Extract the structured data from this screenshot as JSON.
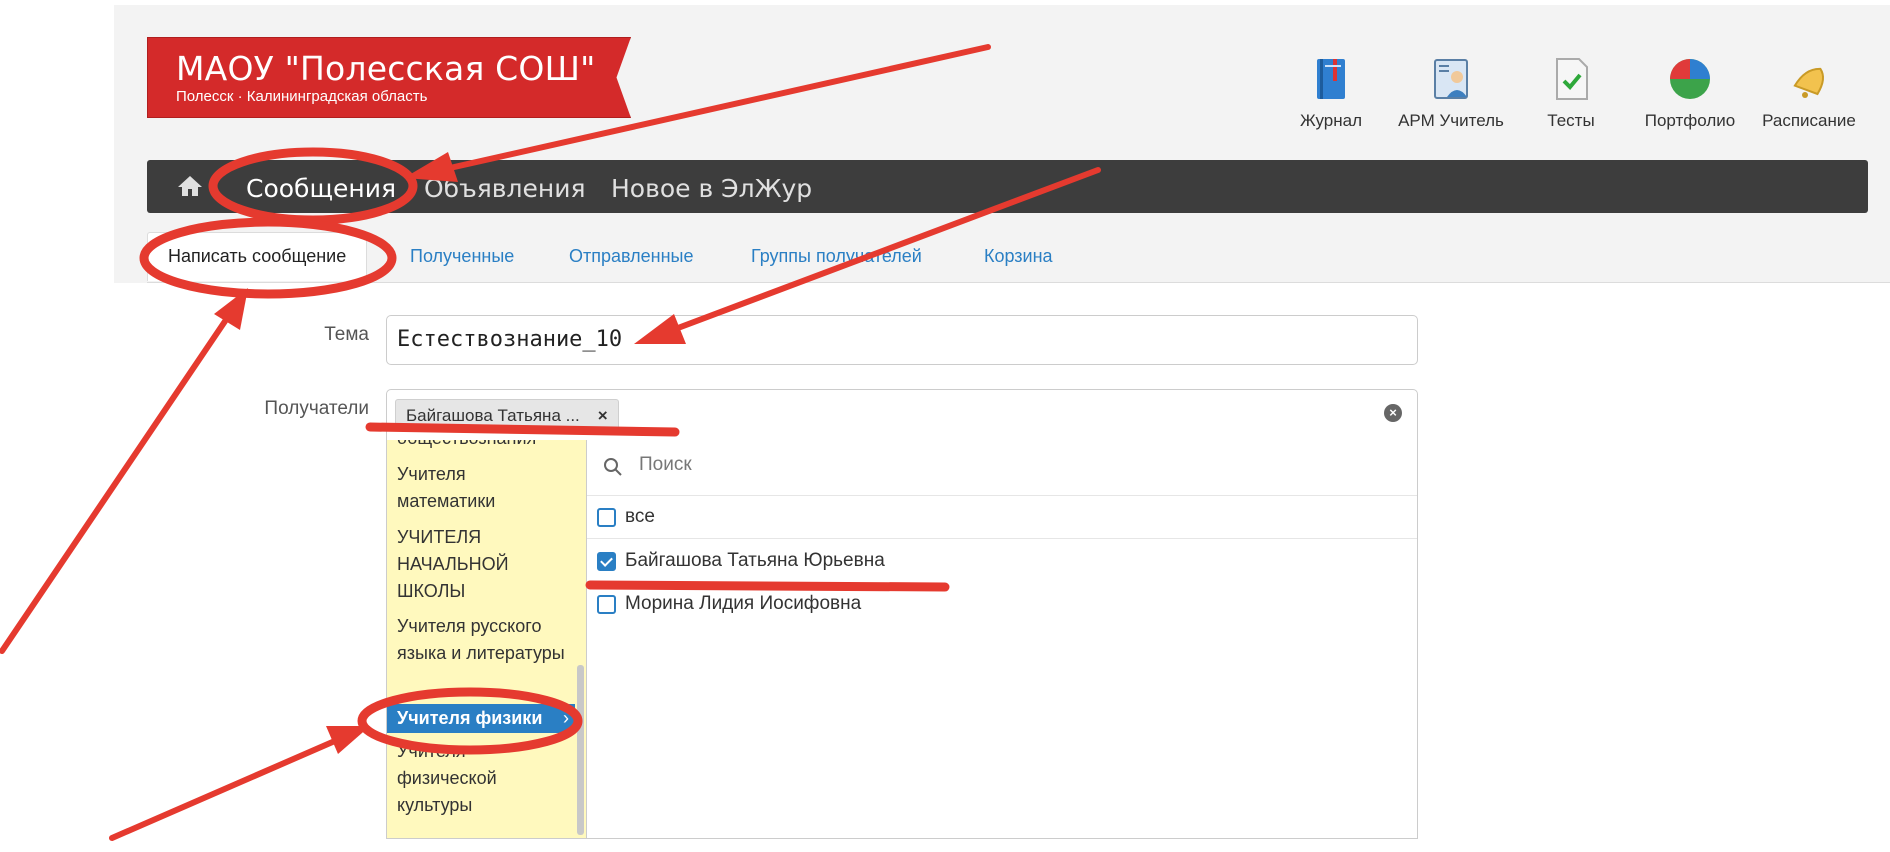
{
  "school": {
    "name": "МАОУ \"Полесская СОШ\"",
    "location": "Полесск · Калининградская область"
  },
  "quick_links": [
    {
      "label": "Журнал",
      "icon": "journal-icon"
    },
    {
      "label": "АРМ Учитель",
      "icon": "teacher-workstation-icon"
    },
    {
      "label": "Тесты",
      "icon": "tests-icon"
    },
    {
      "label": "Портфолио",
      "icon": "portfolio-pie-icon"
    },
    {
      "label": "Расписание",
      "icon": "bell-icon"
    }
  ],
  "nav": {
    "home_icon": "home-icon",
    "items": [
      {
        "label": "Сообщения",
        "active": true
      },
      {
        "label": "Объявления",
        "active": false
      },
      {
        "label": "Новое в ЭлЖур",
        "active": false
      }
    ]
  },
  "subtabs": [
    {
      "label": "Написать сообщение",
      "active": true
    },
    {
      "label": "Полученные",
      "active": false
    },
    {
      "label": "Отправленные",
      "active": false
    },
    {
      "label": "Группы получателей",
      "active": false
    },
    {
      "label": "Корзина",
      "active": false
    }
  ],
  "form": {
    "subject_label": "Тема",
    "subject_value": "Естествознание_10",
    "recipients_label": "Получатели",
    "recipient_chip": "Байгашова Татьяна ...",
    "chip_remove": "×",
    "clear_all": "×"
  },
  "groups": [
    {
      "label": "обществознания",
      "active": false
    },
    {
      "label": "Учителя математики",
      "active": false
    },
    {
      "label": "УЧИТЕЛЯ НАЧАЛЬНОЙ ШКОЛЫ",
      "active": false
    },
    {
      "label": "Учителя русского языка и литературы",
      "active": false
    },
    {
      "label": "Учителя физики",
      "active": true,
      "chevron": "›"
    },
    {
      "label": "Учителя физической культуры",
      "active": false
    }
  ],
  "search": {
    "placeholder": "Поиск"
  },
  "options": [
    {
      "label": "все",
      "checked": false
    },
    {
      "label": "Байгашова Татьяна Юрьевна",
      "checked": true
    },
    {
      "label": "Морина Лидия Иосифовна",
      "checked": false
    }
  ],
  "colors": {
    "brand_red": "#d42a2a",
    "nav_dark": "#3d3d3d",
    "link_blue": "#2a7fc4",
    "group_bg": "#fff9be",
    "annotation_red": "#e53a2f"
  }
}
